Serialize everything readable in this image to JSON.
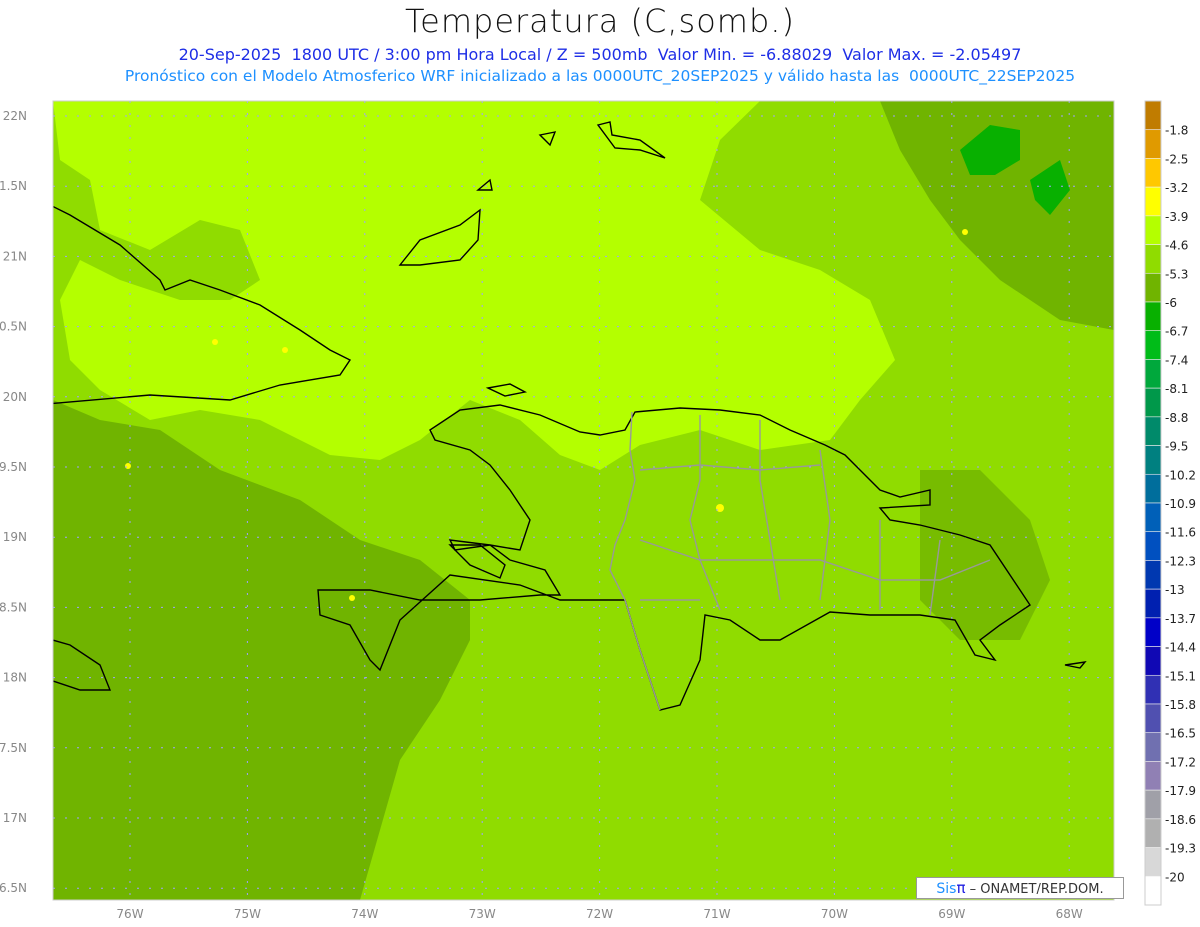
{
  "header": {
    "title": "Temperatura (C,somb.)",
    "line1": "20-Sep-2025  1800 UTC / 3:00 pm Hora Local / Z = 500mb  Valor Min. = -6.88029  Valor Max. = -2.05497",
    "line2": "Pronóstico con el Modelo Atmosferico WRF inicializado a las 0000UTC_20SEP2025 y válido hasta las  0000UTC_22SEP2025"
  },
  "axes": {
    "lon_labels": [
      "76W",
      "75W",
      "74W",
      "73W",
      "72W",
      "71W",
      "70W",
      "69W",
      "68W"
    ],
    "lat_labels": [
      "22N",
      "1.5N",
      "21N",
      "0.5N",
      "20N",
      "9.5N",
      "19N",
      "8.5N",
      "18N",
      "7.5N",
      "17N",
      "6.5N"
    ]
  },
  "colorbar": {
    "labels": [
      "-1.8",
      "-2.5",
      "-3.2",
      "-3.9",
      "-4.6",
      "-5.3",
      "-6",
      "-6.7",
      "-7.4",
      "-8.1",
      "-8.8",
      "-9.5",
      "-10.2",
      "-10.9",
      "-11.6",
      "-12.3",
      "-13",
      "-13.7",
      "-14.4",
      "-15.1",
      "-15.8",
      "-16.5",
      "-17.2",
      "-17.9",
      "-18.6",
      "-19.3",
      "-20"
    ],
    "colors": [
      "#c07c00",
      "#e09a00",
      "#ffc800",
      "#ffff00",
      "#b4ff00",
      "#90dc00",
      "#70b400",
      "#08b000",
      "#00bc18",
      "#00a83c",
      "#00984a",
      "#008a6a",
      "#008080",
      "#006e9c",
      "#0060b8",
      "#0050c0",
      "#0038b0",
      "#0020b0",
      "#0000c8",
      "#1008b4",
      "#3030b4",
      "#5050b0",
      "#7070b0",
      "#9080b4",
      "#a0a0a8",
      "#b0b0b0",
      "#d8d8d8",
      "#ffffff"
    ]
  },
  "credit": {
    "sis": "Sis",
    "pi": "π",
    "org": "– ONAMET/REP.DOM."
  }
}
